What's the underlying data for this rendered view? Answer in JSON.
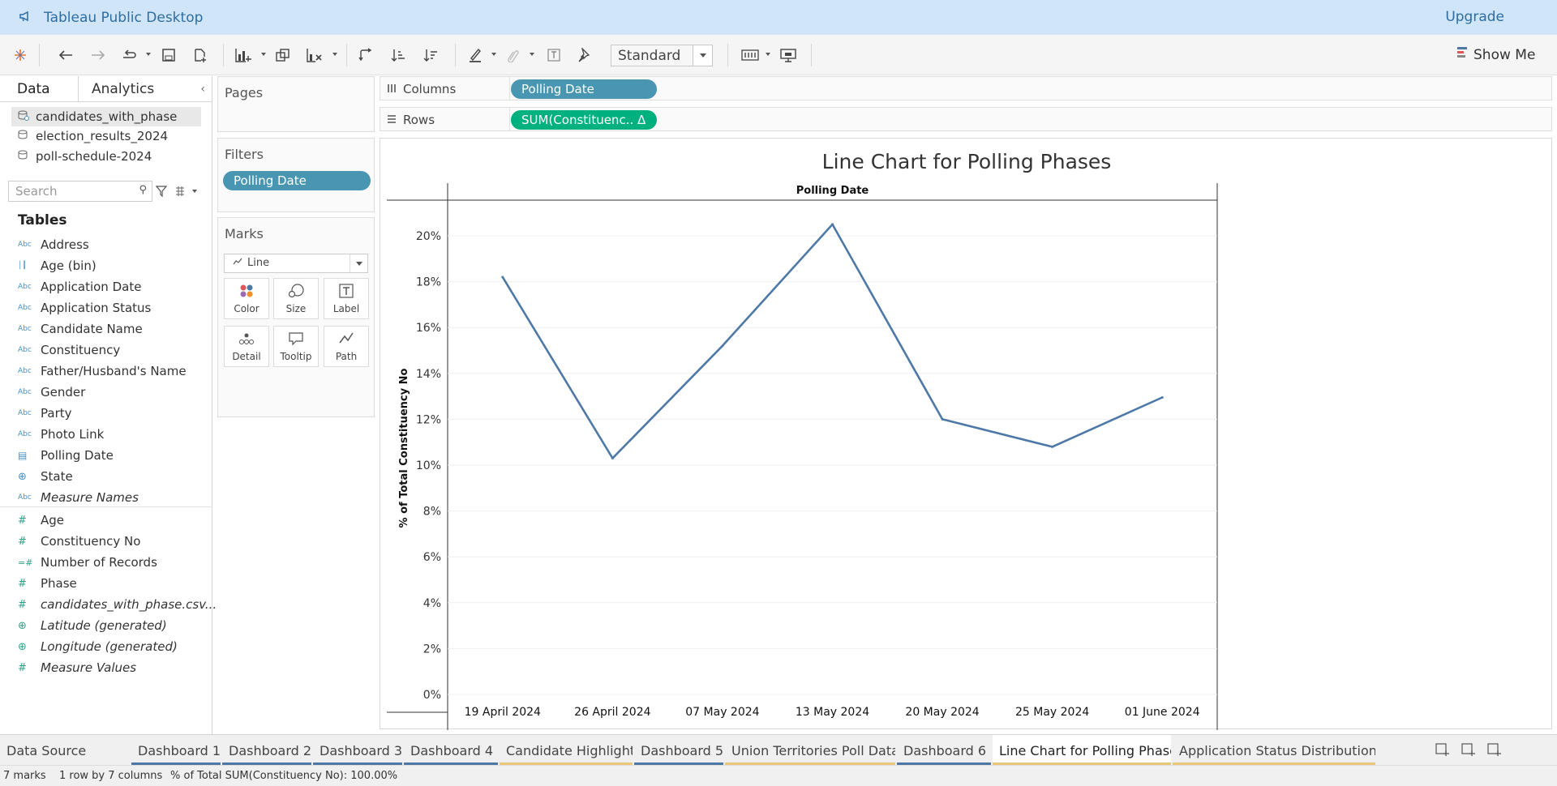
{
  "app": {
    "title": "Tableau Public Desktop",
    "upgrade_label": "Upgrade"
  },
  "toolbar": {
    "fit_value": "Standard",
    "show_me_label": "Show Me"
  },
  "data_pane": {
    "tab_data": "Data",
    "tab_analytics": "Analytics",
    "sources": [
      "candidates_with_phase",
      "election_results_2024",
      "poll-schedule-2024"
    ],
    "search_placeholder": "Search",
    "tables_heading": "Tables",
    "dimensions": [
      {
        "icon": "Abc",
        "label": "Address"
      },
      {
        "icon": "bin",
        "label": "Age (bin)"
      },
      {
        "icon": "Abc",
        "label": "Application Date"
      },
      {
        "icon": "Abc",
        "label": "Application Status"
      },
      {
        "icon": "Abc",
        "label": "Candidate Name"
      },
      {
        "icon": "Abc",
        "label": "Constituency"
      },
      {
        "icon": "Abc",
        "label": "Father/Husband's Name"
      },
      {
        "icon": "Abc",
        "label": "Gender"
      },
      {
        "icon": "Abc",
        "label": "Party"
      },
      {
        "icon": "Abc",
        "label": "Photo Link"
      },
      {
        "icon": "date",
        "label": "Polling Date"
      },
      {
        "icon": "globe",
        "label": "State"
      },
      {
        "icon": "Abc",
        "label": "Measure Names",
        "italic": true
      }
    ],
    "measures": [
      {
        "icon": "#",
        "label": "Age"
      },
      {
        "icon": "#",
        "label": "Constituency No"
      },
      {
        "icon": "=#",
        "label": "Number of Records"
      },
      {
        "icon": "#",
        "label": "Phase"
      },
      {
        "icon": "#",
        "label": "candidates_with_phase.csv...",
        "italic": true
      },
      {
        "icon": "globe",
        "label": "Latitude (generated)",
        "italic": true
      },
      {
        "icon": "globe",
        "label": "Longitude (generated)",
        "italic": true
      },
      {
        "icon": "#",
        "label": "Measure Values",
        "italic": true
      }
    ]
  },
  "cards": {
    "pages_title": "Pages",
    "filters_title": "Filters",
    "filter_pill": "Polling Date",
    "marks_title": "Marks",
    "mark_type": "Line",
    "mark_buttons": [
      "Color",
      "Size",
      "Label",
      "Detail",
      "Tooltip",
      "Path"
    ]
  },
  "shelves": {
    "columns_label": "Columns",
    "rows_label": "Rows",
    "columns_pill": "Polling Date",
    "rows_pill": "SUM(Constituenc.. Δ"
  },
  "chart_data": {
    "type": "line",
    "title": "Line Chart for Polling Phases",
    "header": "Polling Date",
    "ylabel": "% of Total Constituency No",
    "categories": [
      "19 April 2024",
      "26 April 2024",
      "07 May 2024",
      "13 May 2024",
      "20 May 2024",
      "25 May 2024",
      "01 June 2024"
    ],
    "values": [
      18.2,
      10.3,
      15.2,
      20.5,
      12.0,
      10.8,
      12.95
    ],
    "ylim": [
      0,
      21.5
    ],
    "yticks": [
      0,
      2,
      4,
      6,
      8,
      10,
      12,
      14,
      16,
      18,
      20
    ],
    "ytick_labels": [
      "0%",
      "2%",
      "4%",
      "6%",
      "8%",
      "10%",
      "12%",
      "14%",
      "16%",
      "18%",
      "20%"
    ],
    "line_color": "#4e79a7",
    "grid": true
  },
  "sheet_tabs": [
    {
      "label": "Data Source",
      "underline": ""
    },
    {
      "label": "Dashboard 1",
      "underline": "#4e79a7"
    },
    {
      "label": "Dashboard 2",
      "underline": "#4e79a7"
    },
    {
      "label": "Dashboard 3",
      "underline": "#4e79a7"
    },
    {
      "label": "Dashboard 4",
      "underline": "#4e79a7"
    },
    {
      "label": "Candidate Highlights",
      "underline": "#e8c77a"
    },
    {
      "label": "Dashboard 5",
      "underline": "#4e79a7"
    },
    {
      "label": "Union Territories Poll Data",
      "underline": "#e8c77a"
    },
    {
      "label": "Dashboard 6",
      "underline": "#4e79a7"
    },
    {
      "label": "Line Chart for Polling Phases",
      "underline": "#e8c77a",
      "active": true
    },
    {
      "label": "Application Status Distribution ...",
      "underline": "#e8c77a"
    }
  ],
  "status": {
    "marks": "7 marks",
    "dims": "1 row by 7 columns",
    "summary": "% of Total SUM(Constituency No): 100.00%"
  }
}
